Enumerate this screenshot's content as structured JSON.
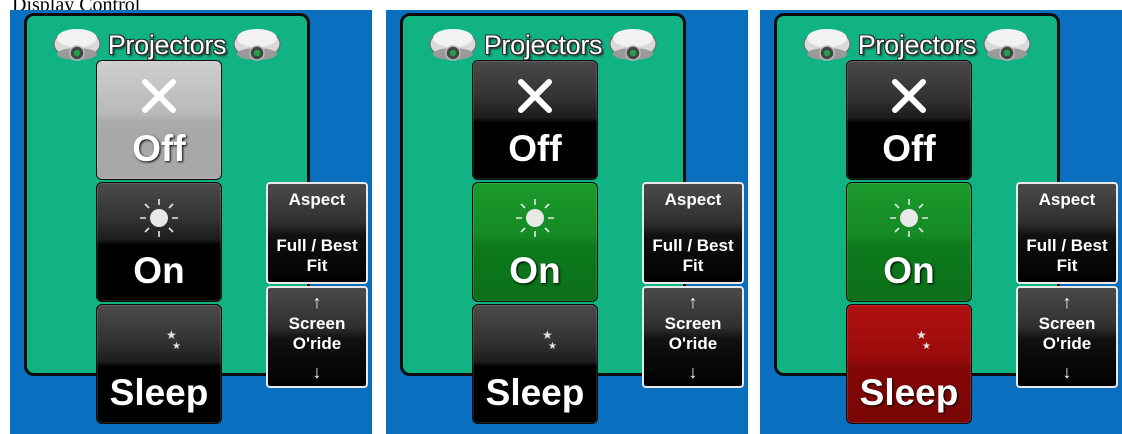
{
  "caption": "Display Control",
  "colors": {
    "panel_bg": "#0a6fbf",
    "group_bg": "#12b383",
    "active_green": "#148a24",
    "active_red": "#9a0b0b",
    "disabled_gray": "#b8b8b8"
  },
  "panels": [
    {
      "title": "Projectors",
      "buttons": {
        "off": {
          "label": "Off",
          "icon": "close-x-icon",
          "state": "disabled"
        },
        "on": {
          "label": "On",
          "icon": "sun-icon",
          "state": "normal"
        },
        "sleep": {
          "label": "Sleep",
          "icon": "moon-stars-icon",
          "state": "normal"
        }
      },
      "aspect": {
        "title": "Aspect",
        "value": "Full / Best Fit"
      },
      "screen": {
        "up": "↑",
        "label": "Screen O'ride",
        "down": "↓"
      }
    },
    {
      "title": "Projectors",
      "buttons": {
        "off": {
          "label": "Off",
          "icon": "close-x-icon",
          "state": "normal"
        },
        "on": {
          "label": "On",
          "icon": "sun-icon",
          "state": "active"
        },
        "sleep": {
          "label": "Sleep",
          "icon": "moon-stars-icon",
          "state": "normal"
        }
      },
      "aspect": {
        "title": "Aspect",
        "value": "Full / Best Fit"
      },
      "screen": {
        "up": "↑",
        "label": "Screen O'ride",
        "down": "↓"
      }
    },
    {
      "title": "Projectors",
      "buttons": {
        "off": {
          "label": "Off",
          "icon": "close-x-icon",
          "state": "normal"
        },
        "on": {
          "label": "On",
          "icon": "sun-icon",
          "state": "active"
        },
        "sleep": {
          "label": "Sleep",
          "icon": "moon-stars-icon",
          "state": "active-red"
        }
      },
      "aspect": {
        "title": "Aspect",
        "value": "Full / Best Fit"
      },
      "screen": {
        "up": "↑",
        "label": "Screen O'ride",
        "down": "↓"
      }
    }
  ]
}
